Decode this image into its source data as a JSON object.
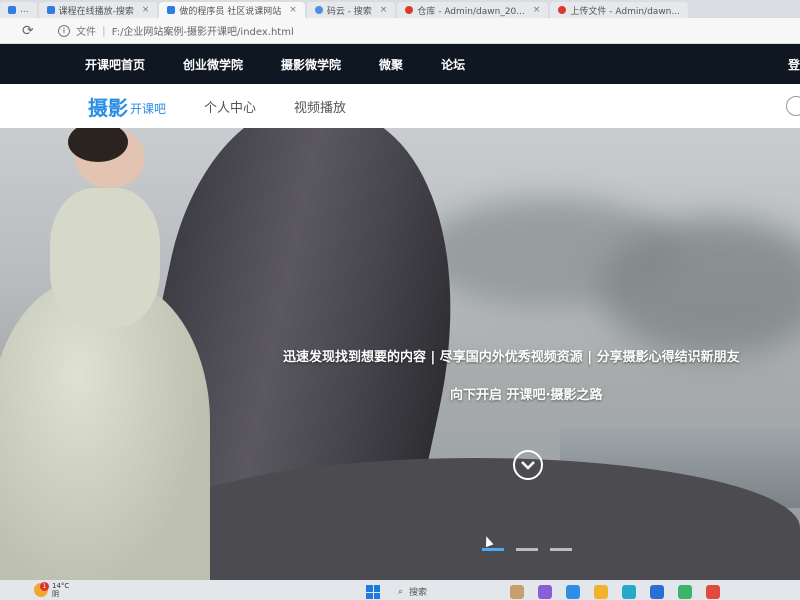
{
  "browser": {
    "tabs": [
      {
        "label": "...",
        "icon": "generic-tab-icon"
      },
      {
        "label": "课程在线播放-搜索",
        "icon": "page-icon"
      },
      {
        "label": "做的程序员 社区说课网站",
        "icon": "page-icon"
      },
      {
        "label": "码云 - 搜索",
        "icon": "search-icon"
      },
      {
        "label": "仓库 - Admin/dawn_20...",
        "icon": "gitee-icon"
      },
      {
        "label": "上传文件 - Admin/dawn...",
        "icon": "gitee-icon"
      }
    ],
    "address": {
      "label": "文件",
      "url": "F:/企业网站案例-摄影开课吧/index.html"
    }
  },
  "site_nav": {
    "items": [
      "开课吧首页",
      "创业微学院",
      "摄影微学院",
      "微聚",
      "论坛"
    ],
    "login": "登"
  },
  "sub_header": {
    "logo_main": "摄影",
    "logo_sub": "开课吧",
    "links": [
      "个人中心",
      "视频播放"
    ]
  },
  "hero": {
    "line1": "迅速发现找到想要的内容 | 尽享国内外优秀视频资源 | 分享摄影心得结识新朋友",
    "line2": "向下开启 开课吧·摄影之路",
    "slide_count": 3,
    "active_slide": 1,
    "colors": {
      "indicator_active": "#4ea8f0",
      "indicator": "#d9d9d9"
    }
  },
  "taskbar": {
    "weather_temp": "14°C",
    "weather_desc": "阴",
    "badge": "1",
    "search_placeholder": "搜索"
  },
  "colors": {
    "nav_bg": "#0e1722",
    "brand_blue": "#2b8ee6"
  }
}
